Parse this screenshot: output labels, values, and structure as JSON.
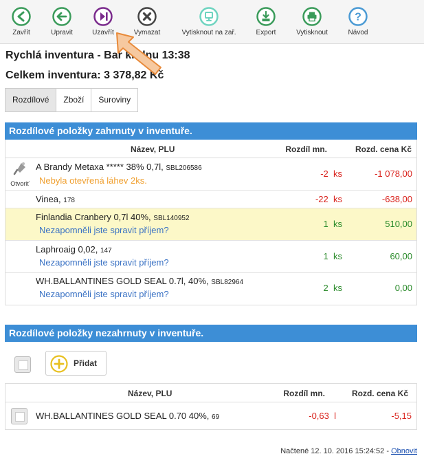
{
  "toolbar": {
    "items": [
      {
        "label": "Zavřít",
        "icon": "close-circle-icon",
        "color": "#3a9b5a"
      },
      {
        "label": "Upravit",
        "icon": "arrow-left-icon",
        "color": "#3a9b5a"
      },
      {
        "label": "Uzavřít",
        "icon": "next-step-icon",
        "color": "#7a2a8c"
      },
      {
        "label": "Vymazat",
        "icon": "delete-x-icon",
        "color": "#444444"
      },
      {
        "label": "Vytisknout na zař.",
        "icon": "print-device-icon",
        "color": "#6ed4c0"
      },
      {
        "label": "Export",
        "icon": "export-icon",
        "color": "#3a9b5a"
      },
      {
        "label": "Vytisknout",
        "icon": "printer-icon",
        "color": "#3a9b5a"
      },
      {
        "label": "Návod",
        "icon": "help-icon",
        "color": "#4a9ad4"
      }
    ]
  },
  "header": {
    "title": "Rychlá inventura - Bar kr dnu 13:38",
    "total": "Celkem inventura: 3 378,82 Kč"
  },
  "tabs": [
    {
      "label": "Rozdílové",
      "active": true
    },
    {
      "label": "Zboží",
      "active": false
    },
    {
      "label": "Suroviny",
      "active": false
    }
  ],
  "section1": {
    "title": "Rozdílové položky zahrnuty v inventuře.",
    "columns": {
      "name": "Název, PLU",
      "qty": "Rozdíl mn.",
      "price": "Rozd. cena Kč"
    },
    "open_label": "Otvoriť",
    "rows": [
      {
        "name": "A Brandy Metaxa ***** 38% 0,7l,",
        "plu": "SBL206586",
        "note": "Nebyla otevřená láhev 2ks.",
        "qty": "-2",
        "unit": "ks",
        "price": "-1 078,00"
      },
      {
        "name": "Vinea,",
        "plu": "178",
        "note": "",
        "qty": "-22",
        "unit": "ks",
        "price": "-638,00"
      },
      {
        "name": "Finlandia Cranbery 0,7l 40%,",
        "plu": "SBL140952",
        "note": "Nezapomněli jste spravit příjem?",
        "qty": "1",
        "unit": "ks",
        "price": "510,00"
      },
      {
        "name": "Laphroaig 0,02,",
        "plu": "147",
        "note": "Nezapomněli jste spravit příjem?",
        "qty": "1",
        "unit": "ks",
        "price": "60,00"
      },
      {
        "name": "WH.BALLANTINES GOLD SEAL 0.7l, 40%,",
        "plu": "SBL82964",
        "note": "Nezapomněli jste spravit příjem?",
        "qty": "2",
        "unit": "ks",
        "price": "0,00"
      }
    ]
  },
  "section2": {
    "title": "Rozdílové položky nezahrnuty v inventuře.",
    "add_label": "Přidat",
    "columns": {
      "name": "Název, PLU",
      "qty": "Rozdíl mn.",
      "price": "Rozd. cena Kč"
    },
    "rows": [
      {
        "name": "WH.BALLANTINES GOLD SEAL 0.70 40%,",
        "plu": "69",
        "qty": "-0,63",
        "unit": "l",
        "price": "-5,15"
      }
    ]
  },
  "footer": {
    "loaded": "Načtené 12. 10. 2016 15:24:52 -",
    "refresh": "Obnovit"
  },
  "colors": {
    "section_header": "#3d8ed6",
    "highlight_row": "#fcf8c8",
    "negative": "#d9221c",
    "positive": "#2a8a2a",
    "note_orange": "#f0a030",
    "note_blue": "#3a72c4"
  }
}
